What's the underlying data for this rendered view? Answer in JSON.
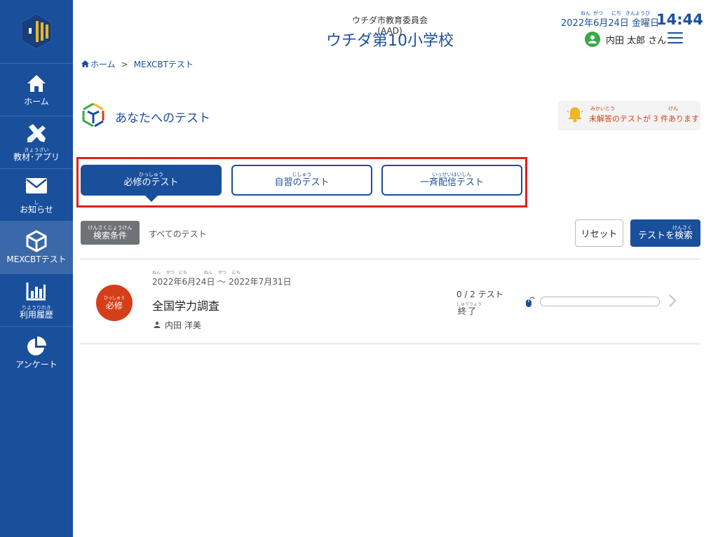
{
  "header": {
    "board_name": "ウチダ市教育委員会(AAD)",
    "school_name": "ウチダ第10小学校",
    "date_text": "2022年6月24日 金曜日",
    "date_ruby": [
      "ねん",
      "がつ",
      "にち",
      "きんようび"
    ],
    "time": "14:44",
    "user_name": "内田 太郎 さん"
  },
  "sidebar": {
    "items": [
      {
        "label": "ホーム",
        "ruby": "",
        "icon": "home-icon"
      },
      {
        "label": "教材･アプリ",
        "ruby": "きょうざい",
        "icon": "pencil-ruler-icon"
      },
      {
        "label": "お知らせ",
        "ruby": "し",
        "icon": "mail-icon"
      },
      {
        "label": "MEXCBTテスト",
        "ruby": "",
        "icon": "cube-icon",
        "active": true
      },
      {
        "label": "利用履歴",
        "ruby": "りようりれき",
        "icon": "bar-chart-icon"
      },
      {
        "label": "アンケート",
        "ruby": "",
        "icon": "pie-chart-icon"
      }
    ]
  },
  "breadcrumb": {
    "home": "ホーム",
    "separator": ">",
    "current": "MEXCBTテスト"
  },
  "page": {
    "title": "あなたへのテスト",
    "notice_ruby": "みかいとう",
    "notice_ruby2": "けん",
    "notice_text": "未解答のテストが 3 件あります"
  },
  "tabs": [
    {
      "label": "必修のテスト",
      "ruby": "ひっしゅう",
      "active": true
    },
    {
      "label": "自習のテスト",
      "ruby": "じしゅう",
      "active": false
    },
    {
      "label": "一斉配信テスト",
      "ruby": "いっせいはいしん",
      "active": false
    }
  ],
  "filter": {
    "condition_ruby": "けんさくじょうけん",
    "condition_label": "検索条件",
    "condition_value": "すべてのテスト",
    "reset_label": "リセット",
    "search_ruby": "けんさく",
    "search_label": "テストを検索"
  },
  "tests": [
    {
      "badge_ruby": "ひっしゅう",
      "badge_label": "必修",
      "dates_ruby": "ねん　 がつ　にち　　　　ねん　 がつ　 にち",
      "dates": "2022年6月24日 ～ 2022年7月31日",
      "name": "全国学力調査",
      "author": "内田 洋美",
      "count": "0 / 2 テスト",
      "status_ruby": "しゅうりょう",
      "status": "終了",
      "progress": 0
    }
  ],
  "colors": {
    "primary": "#1a4f9c",
    "required_badge": "#d43f1a",
    "highlight_frame": "#e02020",
    "notice": "#d0421b"
  }
}
